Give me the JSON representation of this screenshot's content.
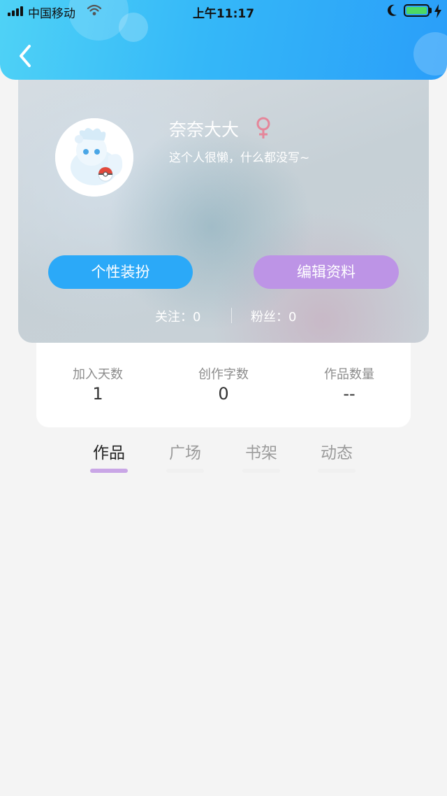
{
  "status_bar": {
    "carrier": "中国移动",
    "time": "上午11:17"
  },
  "profile": {
    "name": "奈奈大大",
    "bio": "这个人很懒，什么都没写~",
    "gender_icon": "female-icon",
    "dress_up_label": "个性装扮",
    "edit_profile_label": "编辑资料",
    "follow_text": "关注：0",
    "fans_text": "粉丝：0"
  },
  "stats": [
    {
      "label": "加入天数",
      "value": "1"
    },
    {
      "label": "创作字数",
      "value": "0"
    },
    {
      "label": "作品数量",
      "value": "--"
    }
  ],
  "tabs": [
    {
      "label": "作品",
      "active": true
    },
    {
      "label": "广场",
      "active": false
    },
    {
      "label": "书架",
      "active": false
    },
    {
      "label": "动态",
      "active": false
    }
  ],
  "colors": {
    "header_start": "#4fd2f6",
    "header_end": "#2a9ef9",
    "dress_up_button": "#2ba9f8",
    "edit_button": "#bd94e6",
    "tab_indicator_active": "#c9a6e6",
    "female_icon": "#e5869a",
    "battery": "#4cd964"
  }
}
